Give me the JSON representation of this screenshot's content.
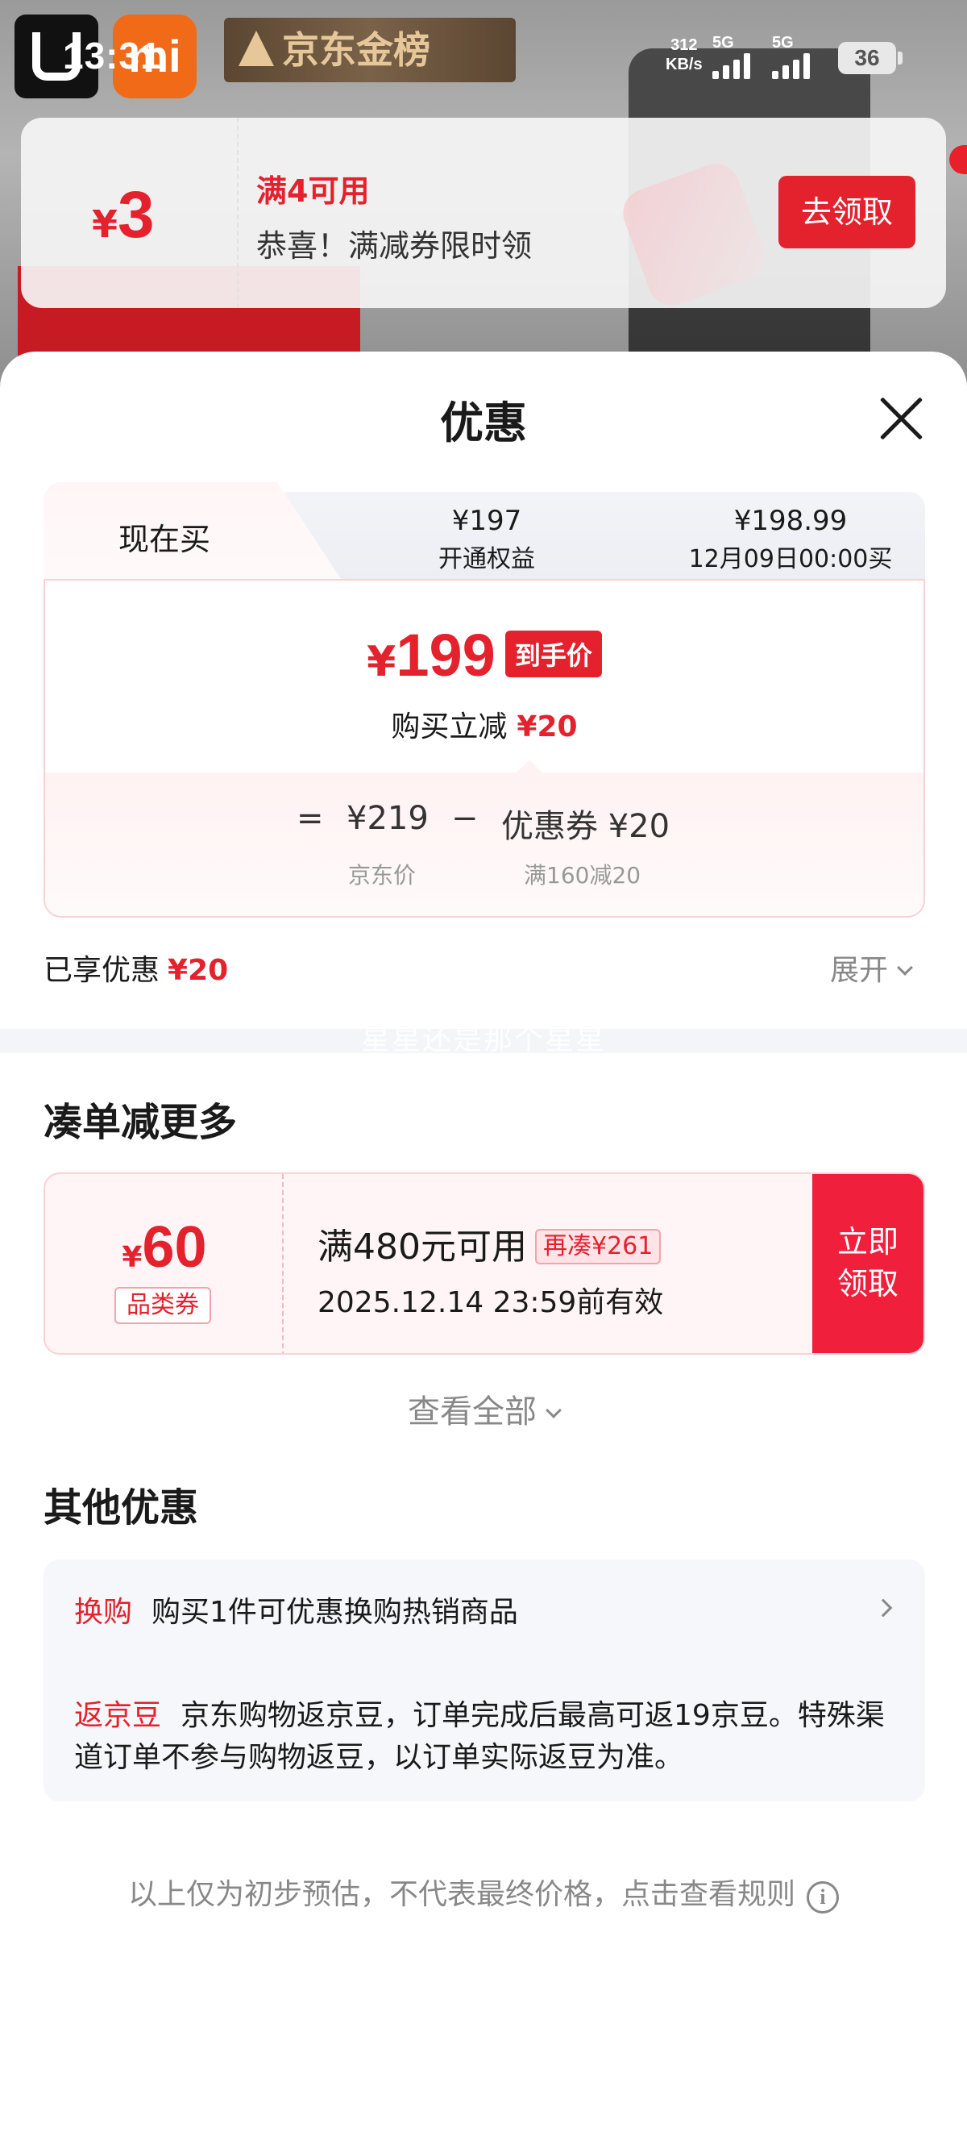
{
  "status_bar": {
    "time": "13:31",
    "net_speed_value": "312",
    "net_speed_unit": "KB/s",
    "sim1_label": "5G",
    "sim2_label": "5G",
    "battery": "36",
    "app_icon_mi2": "mi",
    "banner_text": "京东金榜"
  },
  "toast": {
    "currency": "¥",
    "amount": "3",
    "condition": "满4可用",
    "message": "恭喜！满减券限时领",
    "button": "去领取"
  },
  "sheet": {
    "title": "优惠",
    "price_tabs": {
      "active_label": "现在买",
      "tab2_price": "¥197",
      "tab2_desc": "开通权益",
      "tab3_price": "¥198.99",
      "tab3_desc": "12月09日00:00买"
    },
    "final_price": {
      "currency": "¥",
      "amount": "199",
      "tag": "到手价",
      "sub_label": "购买立减",
      "sub_amount": "¥20"
    },
    "calc": {
      "equals": "=",
      "jd_price": "¥219",
      "jd_price_label": "京东价",
      "minus": "−",
      "coupon": "优惠券 ¥20",
      "coupon_label": "满160减20"
    },
    "enjoyed_label": "已享优惠",
    "enjoyed_amount": "¥20",
    "expand_label": "展开",
    "watermark": "星星还是那个星星"
  },
  "bundle": {
    "title": "凑单减更多",
    "coupon": {
      "currency": "¥",
      "amount": "60",
      "type": "品类券",
      "condition": "满480元可用",
      "more_tag": "再凑¥261",
      "valid_until": "2025.12.14 23:59前有效",
      "button_line1": "立即",
      "button_line2": "领取"
    },
    "see_all": "查看全部"
  },
  "other": {
    "title": "其他优惠",
    "row1_tag": "换购",
    "row1_text": "购买1件可优惠换购热销商品",
    "row2_tag": "返京豆",
    "row2_text": "京东购物返京豆，订单完成后最高可返19京豆。特殊渠道订单不参与购物返豆，以订单实际返豆为准。"
  },
  "footnote": "以上仅为初步预估，不代表最终价格，点击查看规则",
  "colors": {
    "accent_red": "#e3222e",
    "coupon_button": "#f01f3c",
    "muted_text": "#888888"
  }
}
